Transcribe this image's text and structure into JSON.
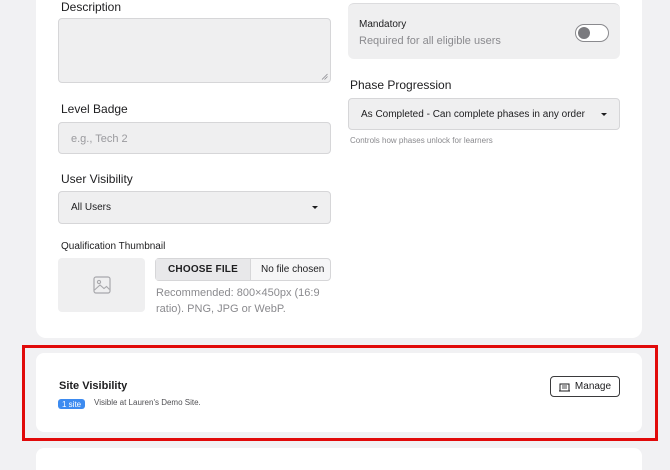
{
  "form": {
    "description_label": "Description",
    "level_badge_label": "Level Badge",
    "level_badge_placeholder": "e.g., Tech 2",
    "user_visibility_label": "User Visibility",
    "user_visibility_value": "All Users",
    "thumbnail_label": "Qualification Thumbnail",
    "file_button": "CHOOSE FILE",
    "file_status": "No file chosen",
    "thumbnail_hint": "Recommended: 800×450px (16:9 ratio). PNG, JPG or WebP.",
    "mandatory_label": "Mandatory",
    "mandatory_desc": "Required for all eligible users",
    "mandatory_on": false,
    "phase_label": "Phase Progression",
    "phase_value": "As Completed - Can complete phases in any order",
    "phase_hint": "Controls how phases unlock for learners"
  },
  "site_visibility": {
    "title": "Site Visibility",
    "badge": "1 site",
    "text": "Visible at Lauren's Demo Site.",
    "manage_button": "Manage"
  },
  "icons": [
    "image-placeholder-icon",
    "building-icon",
    "chevron-down-icon",
    "resize-grip-icon"
  ],
  "colors": {
    "highlight": "#e10a0a",
    "badge": "#3d8bf0"
  }
}
